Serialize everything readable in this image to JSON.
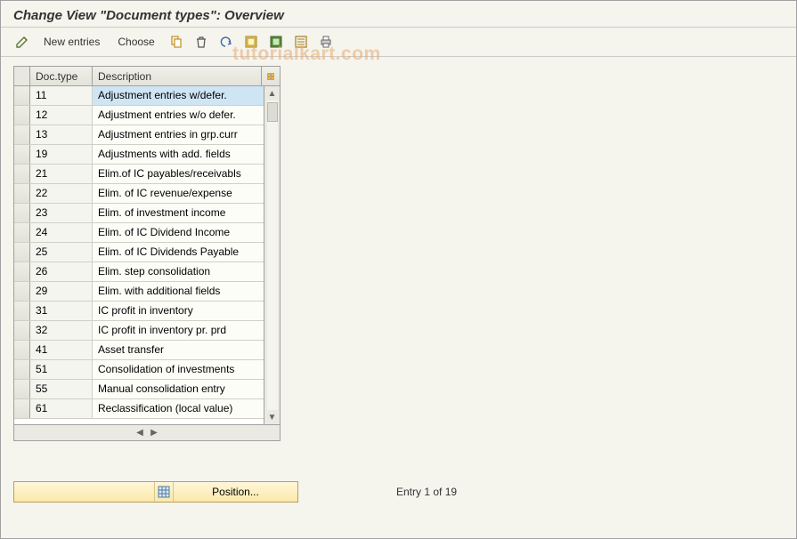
{
  "window_title": "Change View \"Document types\": Overview",
  "toolbar": {
    "new_entries": "New entries",
    "choose": "Choose"
  },
  "watermark": "tutorialkart.com",
  "table": {
    "columns": {
      "doc_type": "Doc.type",
      "description": "Description"
    },
    "rows": [
      {
        "type": "11",
        "desc": "Adjustment entries w/defer.",
        "selected": true
      },
      {
        "type": "12",
        "desc": "Adjustment entries w/o defer."
      },
      {
        "type": "13",
        "desc": "Adjustment entries in grp.curr"
      },
      {
        "type": "19",
        "desc": "Adjustments with add. fields"
      },
      {
        "type": "21",
        "desc": "Elim.of IC payables/receivabls"
      },
      {
        "type": "22",
        "desc": "Elim. of IC revenue/expense"
      },
      {
        "type": "23",
        "desc": "Elim. of investment income"
      },
      {
        "type": "24",
        "desc": "Elim. of IC Dividend Income"
      },
      {
        "type": "25",
        "desc": "Elim. of IC Dividends Payable"
      },
      {
        "type": "26",
        "desc": "Elim. step consolidation"
      },
      {
        "type": "29",
        "desc": "Elim. with additional fields"
      },
      {
        "type": "31",
        "desc": "IC profit in inventory"
      },
      {
        "type": "32",
        "desc": "IC profit in inventory pr. prd"
      },
      {
        "type": "41",
        "desc": "Asset transfer"
      },
      {
        "type": "51",
        "desc": "Consolidation of investments"
      },
      {
        "type": "55",
        "desc": "Manual consolidation entry"
      },
      {
        "type": "61",
        "desc": "Reclassification (local value)"
      }
    ]
  },
  "footer": {
    "position_label": "Position...",
    "entry_text": "Entry 1 of 19"
  }
}
